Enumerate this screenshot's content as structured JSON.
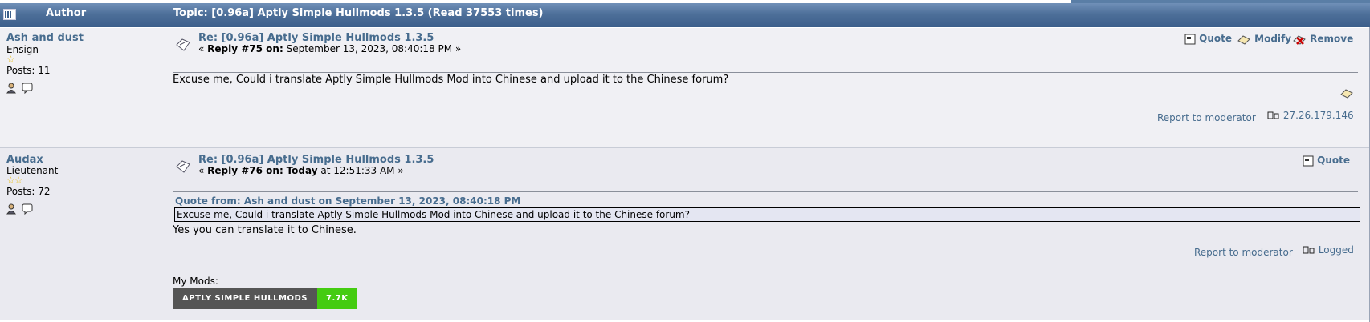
{
  "header": {
    "author_label": "Author",
    "topic_title": "Topic: [0.96a] Aptly Simple Hullmods 1.3.5  (Read 37553 times)"
  },
  "posts": [
    {
      "author": "Ash and dust",
      "rank": "Ensign",
      "stars": "☆",
      "posts": "Posts: 11",
      "subject": "Re: [0.96a] Aptly Simple Hullmods 1.3.5",
      "reply_prefix": "« ",
      "reply_label": "Reply #75 on:",
      "reply_date": " September 13, 2023, 08:40:18 PM »",
      "actions": {
        "quote": "Quote",
        "modify": "Modify",
        "remove": "Remove"
      },
      "body": "Excuse me, Could i translate Aptly Simple Hullmods Mod into Chinese and upload it to the Chinese forum?",
      "report": "Report to moderator",
      "ip": "27.26.179.146"
    },
    {
      "author": "Audax",
      "rank": "Lieutenant",
      "stars": "☆☆",
      "posts": "Posts: 72",
      "subject": "Re: [0.96a] Aptly Simple Hullmods 1.3.5",
      "reply_prefix": "« ",
      "reply_label": "Reply #76 on:",
      "reply_today": "Today",
      "reply_date": " at 12:51:33 AM »",
      "actions": {
        "quote": "Quote"
      },
      "quote_header": "Quote from: Ash and dust on September 13, 2023, 08:40:18 PM",
      "quote_text": "Excuse me, Could i translate Aptly Simple Hullmods Mod into Chinese and upload it to the Chinese forum?",
      "body": "Yes you can translate it to Chinese.",
      "report": "Report to moderator",
      "logged": "Logged",
      "signature_label": "My Mods:",
      "badge_left": "APTLY SIMPLE HULLMODS",
      "badge_right": "7.7K"
    }
  ],
  "colors": {
    "header_bg": "#4d6f99",
    "link": "#476c8e",
    "post_bg": "#f0f0f4",
    "badge_left": "#555555",
    "badge_right": "#44cc11"
  },
  "icons": [
    "board-icon",
    "subject-icon",
    "quote-icon",
    "modify-icon",
    "remove-icon",
    "profile-icon",
    "pm-icon",
    "ip-icon"
  ]
}
